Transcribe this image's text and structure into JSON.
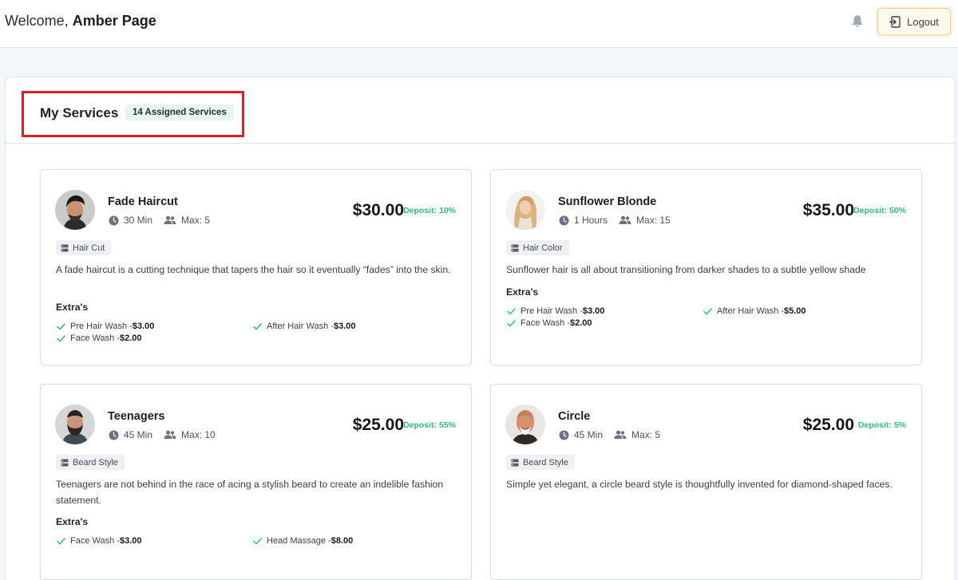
{
  "header": {
    "welcome_prefix": "Welcome,",
    "user_name": "Amber Page",
    "logout_label": "Logout"
  },
  "panel": {
    "title": "My Services",
    "badge": "14 Assigned Services"
  },
  "extras_heading": "Extra's",
  "colors": {
    "accent_green": "#2fbf7b",
    "highlight_red": "#d6202a",
    "logout_border": "#f2cf9a"
  },
  "services": [
    {
      "name": "Fade Haircut",
      "duration": "30 Min",
      "max": "Max: 5",
      "price": "$30.00",
      "deposit": "Deposit: 10%",
      "category": "Hair Cut",
      "description": "A fade haircut is a cutting technique that tapers the hair so it eventually “fades” into the skin.",
      "extras": [
        {
          "label": "Pre Hair Wash -",
          "price": "$3.00"
        },
        {
          "label": "After Hair Wash -",
          "price": "$3.00"
        },
        {
          "label": "Face Wash -",
          "price": "$2.00"
        }
      ]
    },
    {
      "name": "Sunflower Blonde",
      "duration": "1 Hours",
      "max": "Max: 15",
      "price": "$35.00",
      "deposit": "Deposit: 50%",
      "category": "Hair Color",
      "description": "Sunflower hair is all about transitioning from darker shades to a subtle yellow shade",
      "extras": [
        {
          "label": "Pre Hair Wash -",
          "price": "$3.00"
        },
        {
          "label": "After Hair Wash -",
          "price": "$5.00"
        },
        {
          "label": "Face Wash -",
          "price": "$2.00"
        }
      ]
    },
    {
      "name": "Teenagers",
      "duration": "45 Min",
      "max": "Max: 10",
      "price": "$25.00",
      "deposit": "Deposit: 55%",
      "category": "Beard Style",
      "description": "Teenagers are not behind in the race of acing a stylish beard to create an indelible fashion statement.",
      "extras": [
        {
          "label": "Face Wash -",
          "price": "$3.00"
        },
        {
          "label": "Head Massage -",
          "price": "$8.00"
        }
      ]
    },
    {
      "name": "Circle",
      "duration": "45 Min",
      "max": "Max: 5",
      "price": "$25.00",
      "deposit": "Deposit: 5%",
      "category": "Beard Style",
      "description": "Simple yet elegant, a circle beard style is thoughtfully invented for diamond-shaped faces.",
      "extras": []
    }
  ]
}
